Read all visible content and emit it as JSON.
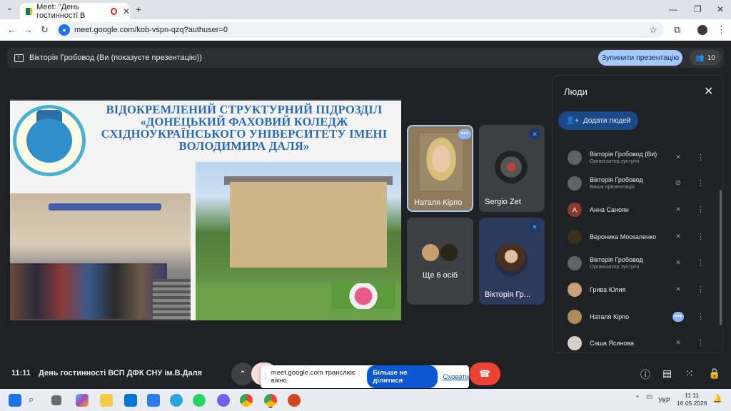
{
  "browser": {
    "tab_title": "Meet: \"День гостинності В",
    "url": "meet.google.com/kob-vspn-qzq?authuser=0"
  },
  "meet": {
    "presenting_label": "Вікторія Гробовод (Ви (показуєте презентацію))",
    "stop_button": "Зупинити презентацію",
    "participant_count": "10",
    "slide": {
      "title_lines": [
        "ВІДОКРЕМЛЕНИЙ СТРУКТУРНИЙ ПІДРОЗДІЛ",
        "«ДОНЕЦЬКИЙ ФАХОВИЙ КОЛЕДЖ",
        "СХІДНОУКРАЇНСЬКОГО УНІВЕРСИТЕТУ ІМЕНІ",
        "ВОЛОДИМИРА ДАЛЯ»"
      ]
    },
    "tiles": [
      {
        "name": "Наталя Кірпо"
      },
      {
        "name": "Sergio Zet"
      },
      {
        "name": "Ще 6 осіб"
      },
      {
        "name": "Вікторія Гр..."
      }
    ],
    "clock": "11:11",
    "meeting_name": "День гостинності ВСП ДФК СНУ ім.В.Даля",
    "toast": {
      "text": "meet.google.com транслює вікно.",
      "share_button": "Більше не ділитися",
      "hide_link": "Сховати"
    }
  },
  "people_panel": {
    "title": "Люди",
    "add_button": "Додати людей",
    "people": [
      {
        "name": "Вікторія Гробовод (Ви)",
        "sub": "Організатор зустрічі",
        "avatar": "#5f6368",
        "initial": ""
      },
      {
        "name": "Вікторія Гробовод",
        "sub": "Ваша презентація",
        "avatar": "#5f6368",
        "initial": ""
      },
      {
        "name": "Анна Саноян",
        "sub": "",
        "avatar": "#8b3a2e",
        "initial": "А"
      },
      {
        "name": "Вероника Москаленко",
        "sub": "",
        "avatar": "#3a3020",
        "initial": ""
      },
      {
        "name": "Вікторія Гробовод",
        "sub": "Організатор зустрічі",
        "avatar": "#5f6368",
        "initial": ""
      },
      {
        "name": "Грива Юлия",
        "sub": "",
        "avatar": "#c9a07a",
        "initial": ""
      },
      {
        "name": "Наталя Кірпо",
        "sub": "",
        "avatar": "#b08a5a",
        "initial": ""
      },
      {
        "name": "Саша Ясинова",
        "sub": "",
        "avatar": "#d9d0c8",
        "initial": ""
      }
    ]
  },
  "taskbar": {
    "lang": "УКР",
    "time": "11:11",
    "date": "16.05.2026"
  }
}
